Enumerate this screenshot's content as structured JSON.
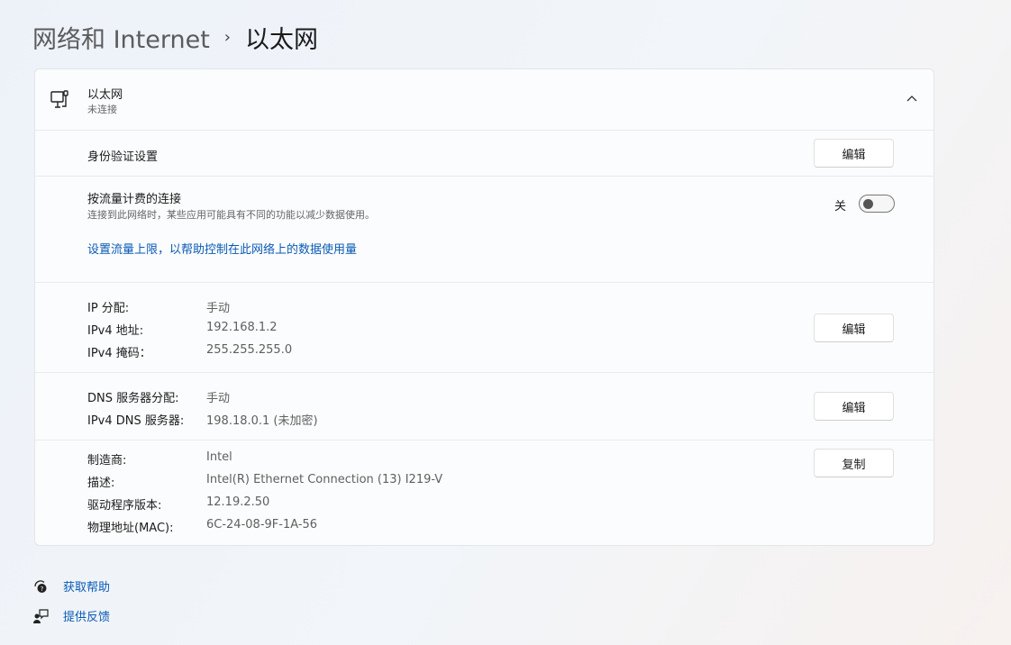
{
  "breadcrumb": {
    "parent": "网络和 Internet",
    "separator": "›",
    "current": "以太网"
  },
  "adapter": {
    "name": "以太网",
    "status": "未连接"
  },
  "auth": {
    "label": "身份验证设置",
    "button": "编辑"
  },
  "metered": {
    "label": "按流量计费的连接",
    "description": "连接到此网络时，某些应用可能具有不同的功能以减少数据使用。",
    "toggle_label": "关",
    "toggle_on": false,
    "link": "设置流量上限，以帮助控制在此网络上的数据使用量"
  },
  "ip": {
    "rows": [
      {
        "label": "IP 分配:",
        "value": "手动"
      },
      {
        "label": "IPv4 地址:",
        "value": "192.168.1.2"
      },
      {
        "label": "IPv4 掩码：",
        "value": "255.255.255.0"
      }
    ],
    "button": "编辑"
  },
  "dns": {
    "rows": [
      {
        "label": "DNS 服务器分配:",
        "value": "手动"
      },
      {
        "label": "IPv4 DNS 服务器:",
        "value": "198.18.0.1 (未加密)"
      }
    ],
    "button": "编辑"
  },
  "hardware": {
    "rows": [
      {
        "label": "制造商:",
        "value": "Intel"
      },
      {
        "label": "描述:",
        "value": "Intel(R) Ethernet Connection (13) I219-V"
      },
      {
        "label": "驱动程序版本:",
        "value": "12.19.2.50"
      },
      {
        "label": "物理地址(MAC):",
        "value": "6C-24-08-9F-1A-56"
      }
    ],
    "button": "复制"
  },
  "footer": {
    "help": "获取帮助",
    "feedback": "提供反馈"
  }
}
